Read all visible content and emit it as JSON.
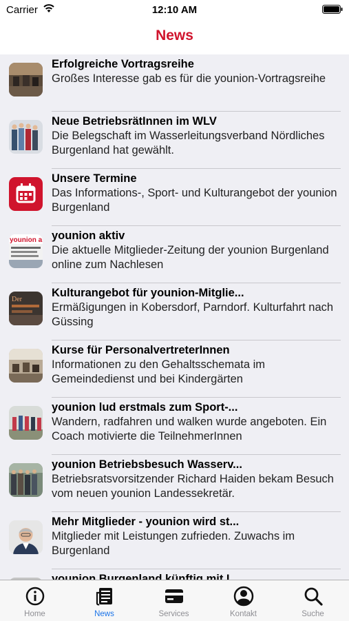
{
  "status_bar": {
    "carrier": "Carrier",
    "time": "12:10 AM"
  },
  "nav": {
    "title": "News"
  },
  "news": [
    {
      "title": "Erfolgreiche Vortragsreihe",
      "subtitle": "Großes Interesse gab es für die younion-Vortragsreihe"
    },
    {
      "title": "Neue BetriebsrätInnen im WLV",
      "subtitle": "Die Belegschaft im Wasserleitungsverband Nördliches Burgenland hat gewählt."
    },
    {
      "title": "Unsere Termine",
      "subtitle": "Das Informations-, Sport- und Kulturangebot der younion Burgenland"
    },
    {
      "title": "younion aktiv",
      "subtitle": "Die aktuelle Mitglieder-Zeitung der younion Burgenland online zum Nachlesen",
      "thumb_text": "younion akt"
    },
    {
      "title": "Kulturangebot für younion-Mitglie...",
      "subtitle": "Ermäßigungen in Kobersdorf, Parndorf. Kulturfahrt nach Güssing",
      "thumb_text": "Der"
    },
    {
      "title": "Kurse für PersonalvertreterInnen",
      "subtitle": "Informationen zu den Gehaltsschemata im Gemeindedienst und bei Kindergärten"
    },
    {
      "title": "younion lud erstmals zum Sport-...",
      "subtitle": "Wandern, radfahren und walken wurde angeboten. Ein Coach motivierte die TeilnehmerInnen"
    },
    {
      "title": "younion Betriebsbesuch Wasserv...",
      "subtitle": "Betriebsratsvorsitzender Richard Haiden bekam Besuch vom neuen younion Landessekretär."
    },
    {
      "title": "Mehr Mitglieder - younion wird st...",
      "subtitle": "Mitglieder mit Leistungen zufrieden. Zuwachs im Burgenland"
    },
    {
      "title": "younion Burgenland künftig mit I",
      "subtitle": ""
    }
  ],
  "tabs": [
    {
      "label": "Home",
      "icon": "info-icon"
    },
    {
      "label": "News",
      "icon": "newspaper-icon",
      "active": true
    },
    {
      "label": "Services",
      "icon": "card-icon"
    },
    {
      "label": "Kontakt",
      "icon": "contact-icon"
    },
    {
      "label": "Suche",
      "icon": "search-icon"
    }
  ],
  "colors": {
    "accent": "#d0142d",
    "tab_active": "#1a73e8",
    "list_bg": "#efeff4"
  }
}
